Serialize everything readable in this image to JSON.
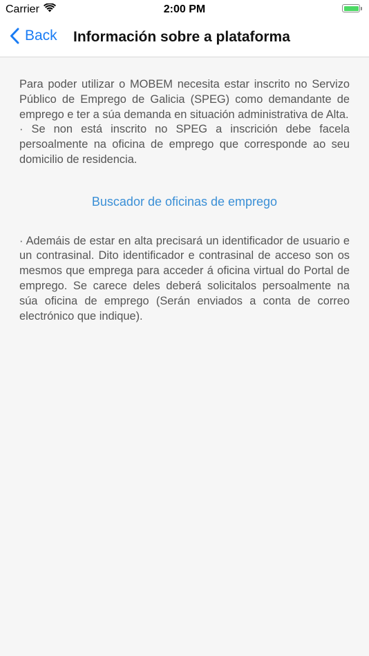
{
  "status_bar": {
    "carrier": "Carrier",
    "time": "2:00 PM",
    "battery_level": 1.0,
    "battery_color": "#4cd964"
  },
  "nav": {
    "back_label": "Back",
    "title": "Información sobre a plataforma",
    "accent_color": "#1a7cf4"
  },
  "content": {
    "para1": "Para poder utilizar o MOBEM necesita estar inscrito no Servizo Público de Emprego de Galicia (SPEG) como demandante de emprego e ter a súa demanda en situación administrativa de Alta.",
    "para2": "· Se non está inscrito no SPEG a inscrición debe facela persoalmente na oficina de emprego que corresponde ao seu domicilio de residencia.",
    "link": "Buscador de oficinas de emprego",
    "para3": "· Ademáis de estar en alta precisará un identificador de usuario e un contrasinal. Dito identificador e contrasinal de acceso son os mesmos que emprega para acceder á oficina virtual do Portal de emprego. Se carece deles deberá solicitalos persoalmente na súa oficina de emprego (Serán enviados a conta de correo electrónico que indique)."
  }
}
